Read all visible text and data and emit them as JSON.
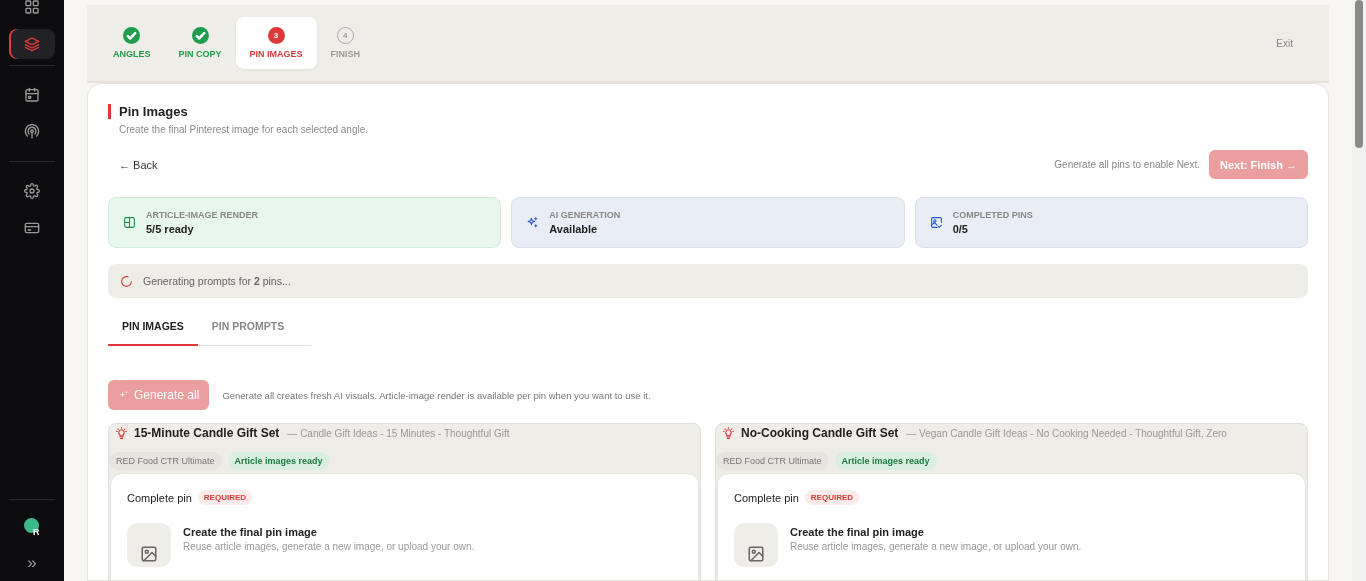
{
  "sidebar": {
    "items": [
      {
        "selected": false
      },
      {
        "selected": true
      },
      {
        "selected": false
      },
      {
        "selected": false
      },
      {
        "selected": false
      },
      {
        "selected": false
      }
    ],
    "avatar": "R",
    "expand": "»"
  },
  "stepper": {
    "steps": [
      {
        "label": "ANGLES",
        "kind": "done",
        "selected": false
      },
      {
        "label": "PIN COPY",
        "kind": "done",
        "selected": false
      },
      {
        "label": "PIN IMAGES",
        "number": "3",
        "kind": "current",
        "selected": true
      },
      {
        "label": "FINISH",
        "number": "4",
        "kind": "pending",
        "selected": false
      }
    ],
    "exit": "Exit"
  },
  "page": {
    "title": "Pin Images",
    "subtitle": "Create the final Pinterest image for each selected angle.",
    "back": "← Back",
    "next_hint": "Generate all pins to enable Next.",
    "next": {
      "label": "Next: Finish →",
      "disabled": true
    }
  },
  "stats": [
    {
      "label": "ARTICLE-IMAGE RENDER",
      "value": "5/5 ready",
      "kind": "ready"
    },
    {
      "label": "AI GENERATION",
      "value": "Available",
      "kind": "info"
    },
    {
      "label": "COMPLETED PINS",
      "value": "0/5",
      "kind": "info"
    }
  ],
  "status": "Generating prompts for **2** pins...",
  "tabs": [
    {
      "label": "PIN IMAGES",
      "selected": true
    },
    {
      "label": "PIN PROMPTS",
      "selected": false
    }
  ],
  "generate": {
    "label": "Generate all",
    "disabled": true,
    "hint": "Generate all creates fresh AI visuals. Article-image render is available per pin when you want to use it."
  },
  "pins": [
    {
      "title": "15-Minute Candle Gift Set",
      "subtitle": "— Candle Gift Ideas - 15 Minutes - Thoughtful Gift",
      "tags": [
        {
          "label": "RED Food CTR Ultimate",
          "kind": "neutral"
        },
        {
          "label": "Article images ready",
          "kind": "success"
        }
      ],
      "section": "Complete pin",
      "badge": "REQUIRED",
      "task": "Create the final pin image",
      "task_desc": "Reuse article images, generate a new image, or upload your own."
    },
    {
      "title": "No-Cooking Candle Gift Set",
      "subtitle": "— Vegan Candle Gift Ideas - No Cooking Needed - Thoughtful Gift, Zero",
      "tags": [
        {
          "label": "RED Food CTR Ultimate",
          "kind": "neutral"
        },
        {
          "label": "Article images ready",
          "kind": "success"
        }
      ],
      "section": "Complete pin",
      "badge": "REQUIRED",
      "task": "Create the final pin image",
      "task_desc": "Reuse article images, generate a new image, or upload your own."
    }
  ]
}
